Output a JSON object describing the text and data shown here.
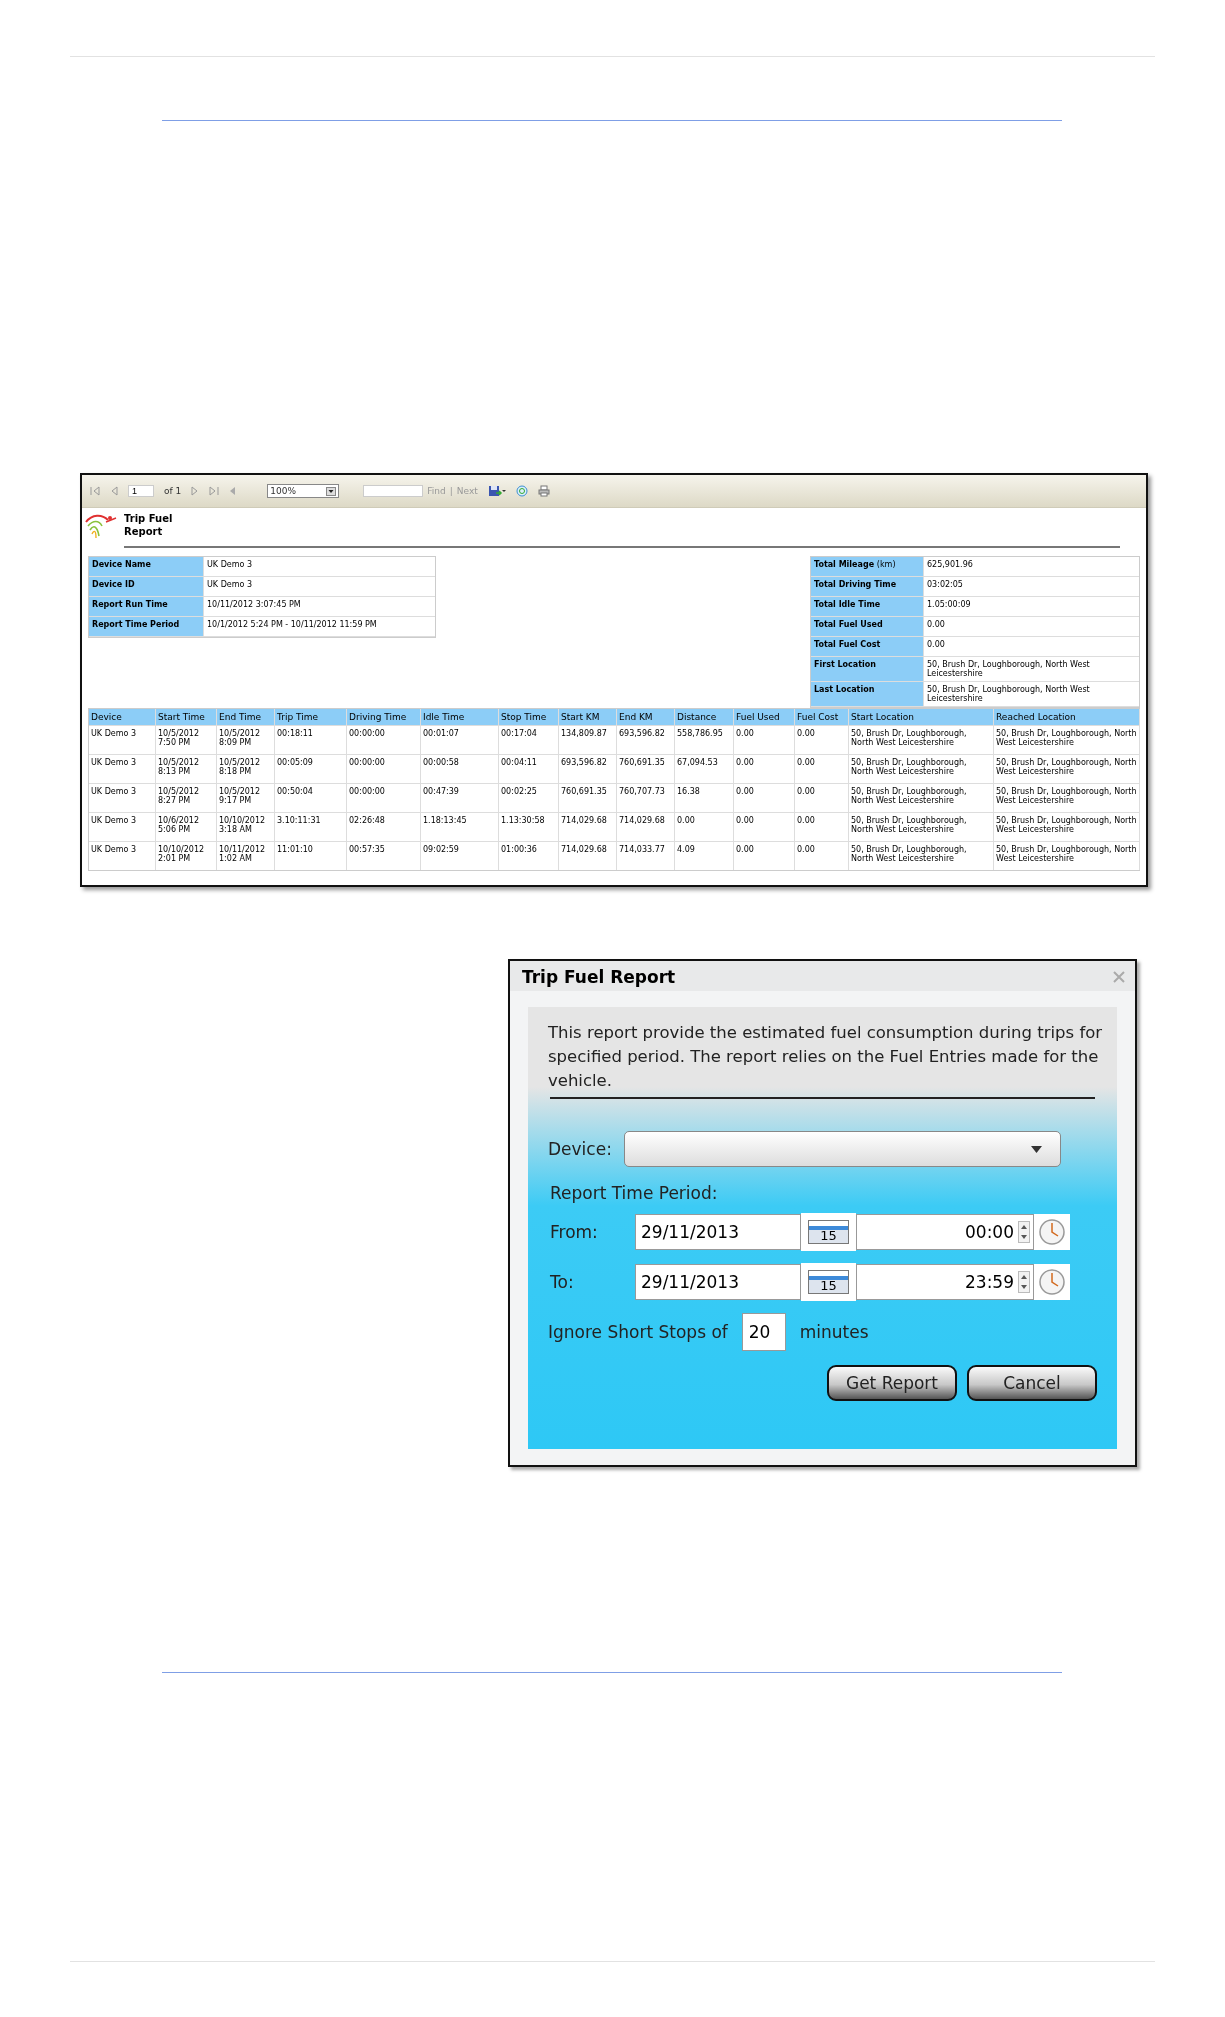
{
  "report_viewer": {
    "toolbar": {
      "page": "1",
      "page_count": "of 1",
      "zoom": "100%",
      "find": "Find",
      "separator": "|",
      "next": "Next"
    },
    "title": "Trip Fuel Report",
    "summary_left": [
      {
        "label": "Device Name",
        "value": "UK Demo 3"
      },
      {
        "label": "Device ID",
        "value": "UK Demo 3"
      },
      {
        "label": "Report Run Time",
        "value": "10/11/2012 3:07:45 PM"
      },
      {
        "label": "Report Time Period",
        "value": "10/1/2012 5:24 PM - 10/11/2012 11:59 PM"
      }
    ],
    "summary_right": [
      {
        "label": "Total Mileage",
        "unit": "(km)",
        "value": "625,901.96"
      },
      {
        "label": "Total Driving Time",
        "value": "03:02:05"
      },
      {
        "label": "Total Idle Time",
        "value": "1.05:00:09"
      },
      {
        "label": "Total Fuel Used",
        "value": "0.00"
      },
      {
        "label": "Total Fuel Cost",
        "value": "0.00"
      },
      {
        "label": "First Location",
        "value": "50, Brush Dr, Loughborough, North West Leicestershire"
      },
      {
        "label": "Last Location",
        "value": "50, Brush Dr, Loughborough, North West Leicestershire"
      }
    ],
    "table": {
      "columns": [
        "Device",
        "Start Time",
        "End Time",
        "Trip Time",
        "Driving Time",
        "Idle Time",
        "Stop Time",
        "Start KM",
        "End KM",
        "Distance",
        "Fuel Used",
        "Fuel Cost",
        "Start Location",
        "Reached Location"
      ],
      "rows": [
        [
          "UK Demo 3",
          "10/5/2012 7:50 PM",
          "10/5/2012 8:09 PM",
          "00:18:11",
          "00:00:00",
          "00:01:07",
          "00:17:04",
          "134,809.87",
          "693,596.82",
          "558,786.95",
          "0.00",
          "0.00",
          "50, Brush Dr, Loughborough, North West Leicestershire",
          "50, Brush Dr, Loughborough, North West Leicestershire"
        ],
        [
          "UK Demo 3",
          "10/5/2012 8:13 PM",
          "10/5/2012 8:18 PM",
          "00:05:09",
          "00:00:00",
          "00:00:58",
          "00:04:11",
          "693,596.82",
          "760,691.35",
          "67,094.53",
          "0.00",
          "0.00",
          "50, Brush Dr, Loughborough, North West Leicestershire",
          "50, Brush Dr, Loughborough, North West Leicestershire"
        ],
        [
          "UK Demo 3",
          "10/5/2012 8:27 PM",
          "10/5/2012 9:17 PM",
          "00:50:04",
          "00:00:00",
          "00:47:39",
          "00:02:25",
          "760,691.35",
          "760,707.73",
          "16.38",
          "0.00",
          "0.00",
          "50, Brush Dr, Loughborough, North West Leicestershire",
          "50, Brush Dr, Loughborough, North West Leicestershire"
        ],
        [
          "UK Demo 3",
          "10/6/2012 5:06 PM",
          "10/10/2012 3:18 AM",
          "3.10:11:31",
          "02:26:48",
          "1.18:13:45",
          "1.13:30:58",
          "714,029.68",
          "714,029.68",
          "0.00",
          "0.00",
          "0.00",
          "50, Brush Dr, Loughborough, North West Leicestershire",
          "50, Brush Dr, Loughborough, North West Leicestershire"
        ],
        [
          "UK Demo 3",
          "10/10/2012 2:01 PM",
          "10/11/2012 1:02 AM",
          "11:01:10",
          "00:57:35",
          "09:02:59",
          "01:00:36",
          "714,029.68",
          "714,033.77",
          "4.09",
          "0.00",
          "0.00",
          "50, Brush Dr, Loughborough, North West Leicestershire",
          "50, Brush Dr, Loughborough, North West Leicestershire"
        ]
      ]
    }
  },
  "dialog": {
    "title": "Trip Fuel Report",
    "description": "This report provide the estimated fuel consumption during trips for specified period. The report relies on the Fuel Entries made for the vehicle.",
    "device_label": "Device:",
    "period_label": "Report Time Period:",
    "ranges": [
      {
        "label": "From:",
        "date": "29/11/2013",
        "calendar_day": "15",
        "time": "00:00"
      },
      {
        "label": "To:",
        "date": "29/11/2013",
        "calendar_day": "15",
        "time": "23:59"
      }
    ],
    "ignore_label": "Ignore Short Stops of",
    "ignore_value": "20",
    "ignore_unit": "minutes",
    "buttons": [
      "Get Report",
      "Cancel"
    ]
  }
}
